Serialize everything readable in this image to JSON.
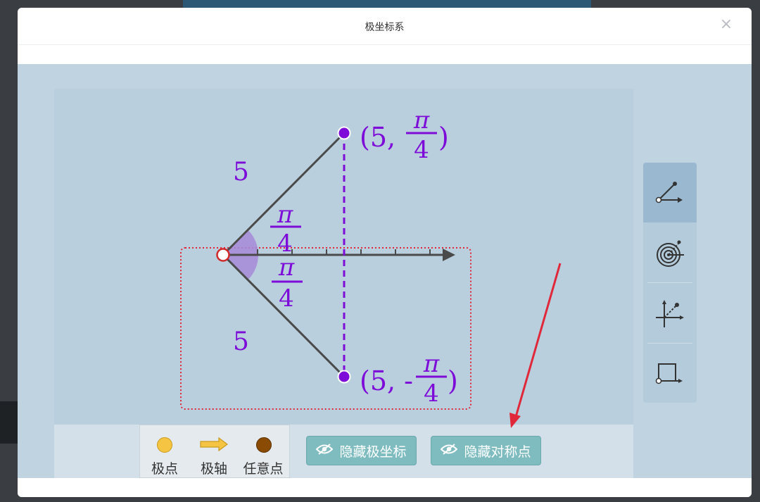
{
  "dialog": {
    "title": "极坐标系",
    "close_icon": "close-icon"
  },
  "diagram": {
    "upper_point_label_prefix": "(5,",
    "upper_point_label_suffix": ")",
    "lower_point_label_prefix": "(5, -",
    "lower_point_label_suffix": ")",
    "pi": "π",
    "four": "4",
    "upper_radius_label": "5",
    "lower_radius_label": "5",
    "point_color": "#7d0cd8",
    "ray_color": "#4a4a4a",
    "angle_fill": "#a78ad8",
    "selection_color": "#e0283a"
  },
  "legend": {
    "items": [
      {
        "label": "极点",
        "icon": "pole-dot-icon",
        "color": "#f5c443"
      },
      {
        "label": "极轴",
        "icon": "polar-axis-arrow-icon",
        "color": "#f5c443"
      },
      {
        "label": "任意点",
        "icon": "any-point-dot-icon",
        "color": "#8a4c05"
      }
    ]
  },
  "buttons": {
    "hide_polar_coords": "隐藏极坐标",
    "hide_symmetric_point": "隐藏对称点"
  },
  "toolbar": {
    "tools": [
      {
        "icon": "polar-point-tool-icon",
        "active": true
      },
      {
        "icon": "radar-target-tool-icon",
        "active": false
      },
      {
        "icon": "cartesian-point-tool-icon",
        "active": false
      },
      {
        "icon": "rectangle-tool-icon",
        "active": false
      }
    ]
  },
  "colors": {
    "accent_button": "#7fbcc0",
    "stage": "#c0d3e0"
  }
}
